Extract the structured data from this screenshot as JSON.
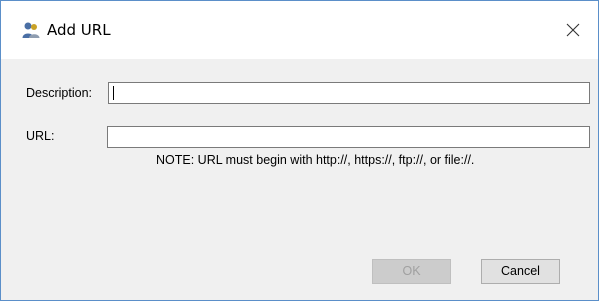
{
  "window": {
    "title": "Add URL",
    "icon": "people-icon",
    "close_glyph": "✕"
  },
  "form": {
    "description_label": "Description:",
    "description_value": "",
    "url_label": "URL:",
    "url_value": "",
    "note": "NOTE:  URL must begin with http://, https://, ftp://, or file://."
  },
  "buttons": {
    "ok_label": "OK",
    "ok_enabled": false,
    "cancel_label": "Cancel"
  },
  "colors": {
    "window_border": "#5b8fc9",
    "dialog_background": "#f0f0f0",
    "disabled_button": "#cccccc"
  }
}
